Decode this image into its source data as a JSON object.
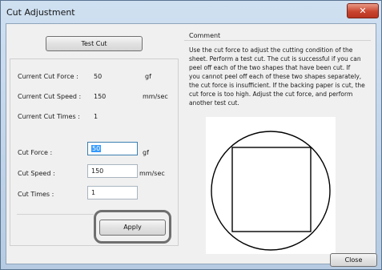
{
  "window": {
    "title": "Cut Adjustment",
    "close_glyph": "✕"
  },
  "left": {
    "test_cut_label": "Test Cut",
    "current": [
      {
        "label": "Current Cut Force :",
        "value": "50",
        "unit": "gf"
      },
      {
        "label": "Current Cut Speed :",
        "value": "150",
        "unit": "mm/sec"
      },
      {
        "label": "Current Cut Times :",
        "value": "1",
        "unit": ""
      }
    ],
    "settings": [
      {
        "label": "Cut Force :",
        "value": "50",
        "unit": "gf"
      },
      {
        "label": "Cut Speed :",
        "value": "150",
        "unit": "mm/sec"
      },
      {
        "label": "Cut Times :",
        "value": "1",
        "unit": ""
      }
    ],
    "apply_label": "Apply"
  },
  "right": {
    "comment_title": "Comment",
    "comment_lines": [
      "Use the cut force to adjust the cutting condition of the",
      "sheet. Perform a test cut. The cut is successful if you can",
      "peel off each of the two shapes that have been cut. If",
      "you cannot peel off each of these two shapes separately,",
      "the cut force is insufficient. If the backing paper is cut, the",
      "cut force is too high. Adjust the cut force, and perform",
      "another test cut."
    ],
    "close_label": "Close"
  }
}
